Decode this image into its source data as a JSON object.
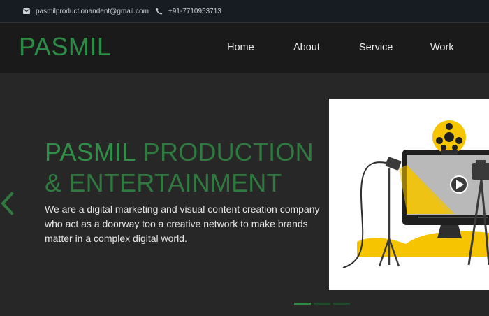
{
  "topbar": {
    "email": "pasmilproductionandent@gmail.com",
    "email_icon": "envelope-icon",
    "phone": "+91-7710953713",
    "phone_icon": "phone-icon"
  },
  "nav": {
    "logo": "PASMIL",
    "links": [
      "Home",
      "About",
      "Service",
      "Work"
    ]
  },
  "hero": {
    "headline_strong": "PASMIL",
    "headline_rest_line1": " PRODUCTION",
    "headline_line2": "& ENTERTAINMENT",
    "description": "We are a digital marketing and visual content creation company who act as a doorway too a creative network to make brands matter in a complex digital world.",
    "prev_icon": "chevron-left-icon",
    "illustration_icon": "film-projector-illustration"
  },
  "carousel": {
    "slides": 3,
    "active_index": 0
  },
  "colors": {
    "brand_green": "#2e8b45",
    "headline_green": "#2e7a3f",
    "background": "#272727",
    "topbar": "#171c22",
    "navbar": "#1a1a1a",
    "accent_yellow": "#f6c400"
  }
}
